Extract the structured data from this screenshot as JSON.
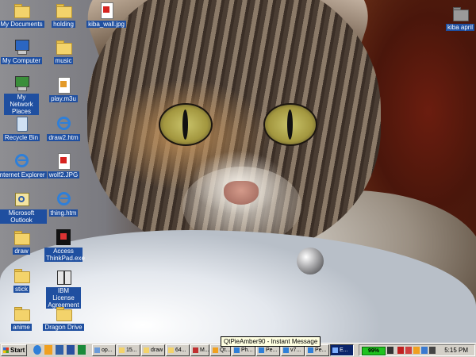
{
  "desktop": {
    "icons": [
      {
        "label": "My Documents"
      },
      {
        "label": "My Computer"
      },
      {
        "label": "My Network Places"
      },
      {
        "label": "Recycle Bin"
      },
      {
        "label": "Internet Explorer"
      },
      {
        "label": "Microsoft Outlook"
      },
      {
        "label": "draw"
      },
      {
        "label": "stick"
      },
      {
        "label": "anime"
      },
      {
        "label": "holding"
      },
      {
        "label": "music"
      },
      {
        "label": "play.m3u"
      },
      {
        "label": "draw2.htm"
      },
      {
        "label": "wolf2.JPG"
      },
      {
        "label": "thing.htm"
      },
      {
        "label": "Access ThinkPad.exe"
      },
      {
        "label": "IBM License Agreement"
      },
      {
        "label": "Dragon Drive"
      },
      {
        "label": "kiba_wall.jpg"
      },
      {
        "label": "kiba april"
      }
    ]
  },
  "tooltip": {
    "text": "QtPieAmber90 - Instant Message"
  },
  "taskbar": {
    "start_label": "Start",
    "buttons": [
      {
        "label": "op..."
      },
      {
        "label": "15..."
      },
      {
        "label": "draw"
      },
      {
        "label": "64..."
      },
      {
        "label": "M..."
      },
      {
        "label": "Qt..."
      },
      {
        "label": "Ph..."
      },
      {
        "label": "Pe..."
      },
      {
        "label": "v7..."
      },
      {
        "label": "Pe..."
      },
      {
        "label": "E..."
      }
    ],
    "tray": {
      "battery": "99%",
      "clock": "5:15 PM"
    }
  },
  "colors": {
    "selection": "#1f4fa0",
    "taskbar": "#d4d0c8",
    "folder": "#f3d36b",
    "battery": "#1fc21f"
  }
}
